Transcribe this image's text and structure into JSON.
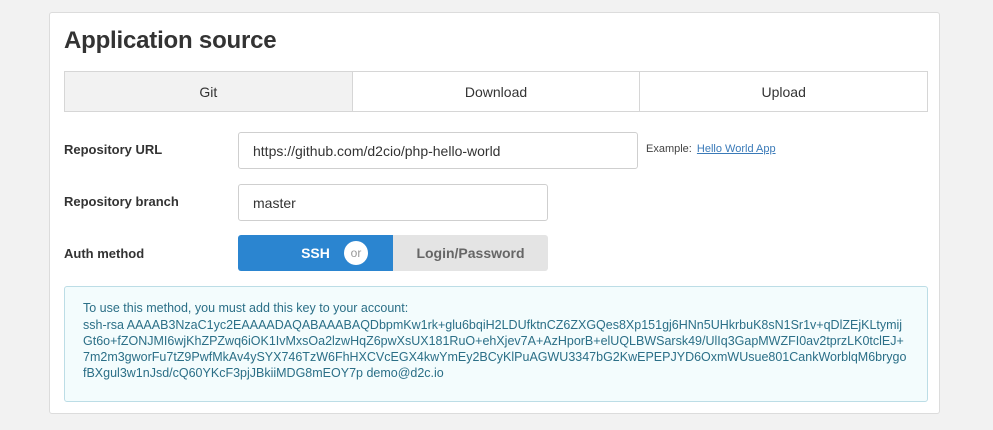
{
  "section": {
    "title": "Application source"
  },
  "tabs": [
    {
      "label": "Git"
    },
    {
      "label": "Download"
    },
    {
      "label": "Upload"
    }
  ],
  "repository_url": {
    "label": "Repository URL",
    "value": "https://github.com/d2cio/php-hello-world",
    "example_prefix": "Example:",
    "example_link": "Hello World App"
  },
  "repository_branch": {
    "label": "Repository branch",
    "value": "master"
  },
  "auth_method": {
    "label": "Auth method",
    "options": [
      "SSH",
      "Login/Password"
    ],
    "separator": "or",
    "selected": "SSH"
  },
  "ssh_key": {
    "intro": "To use this method, you must add this key to your account:",
    "key": "ssh-rsa AAAAB3NzaC1yc2EAAAADAQABAAABAQDbpmKw1rk+glu6bqiH2LDUfktnCZ6ZXGQes8Xp151gj6HNn5UHkrbuK8sN1Sr1v+qDlZEjKLtymijGt6o+fZONJMI6wjKhZPZwq6iOK1IvMxsOa2lzwHqZ6pwXsUX181RuO+ehXjev7A+AzHporB+elUQLBWSarsk49/UlIq3GapMWZFI0av2tprzLK0tclEJ+7m2m3gworFu7tZ9PwfMkAv4ySYX746TzW6FhHXCVcEGX4kwYmEy2BCyKlPuAGWU3347bG2KwEPEPJYD6OxmWUsue801CankWorblqM6brygofBXgul3w1nJsd/cQ60YKcF3pjJBkiiMDG8mEOY7p demo@d2c.io"
  },
  "colors": {
    "accent": "#2b85d0",
    "info_bg": "#f3fcfd",
    "info_text": "#2b6f87"
  }
}
